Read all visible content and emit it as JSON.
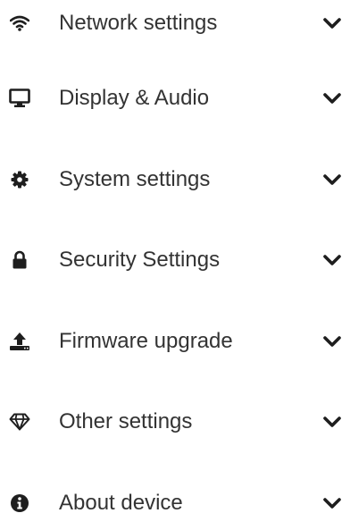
{
  "menu": {
    "items": [
      {
        "label": "Network settings",
        "icon": "wifi-icon"
      },
      {
        "label": "Display & Audio",
        "icon": "monitor-icon"
      },
      {
        "label": "System settings",
        "icon": "gear-icon"
      },
      {
        "label": "Security Settings",
        "icon": "lock-icon"
      },
      {
        "label": "Firmware upgrade",
        "icon": "upload-icon"
      },
      {
        "label": "Other settings",
        "icon": "diamond-icon"
      },
      {
        "label": "About device",
        "icon": "info-icon"
      }
    ],
    "expand_icon": "chevron-down-icon"
  },
  "colors": {
    "text": "#333333",
    "icon": "#1e1e1e"
  }
}
